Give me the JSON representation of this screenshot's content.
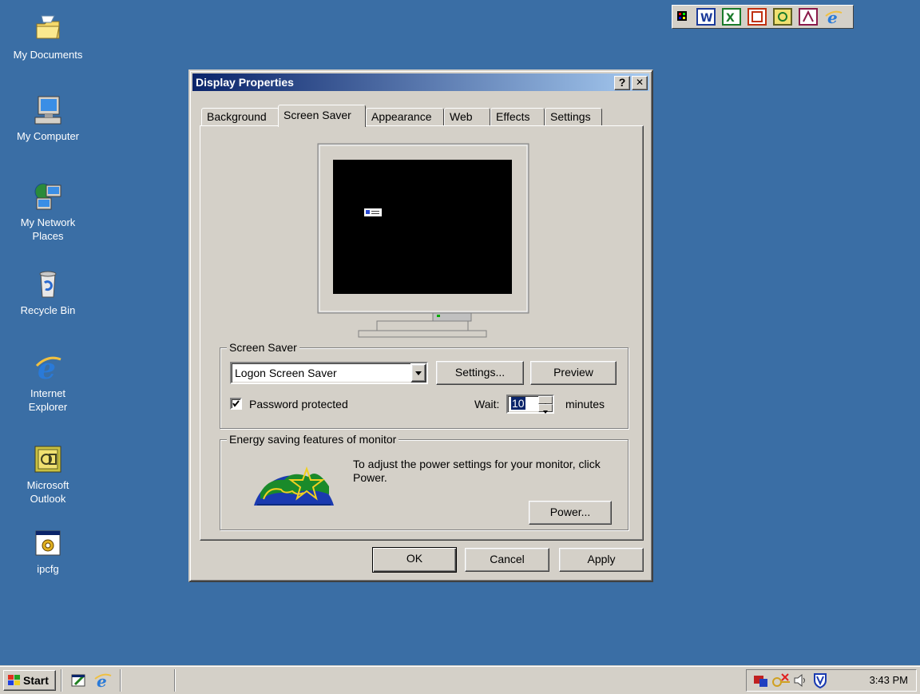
{
  "desktop": {
    "icons": [
      {
        "label": "My Documents"
      },
      {
        "label": "My Computer"
      },
      {
        "label": "My Network Places"
      },
      {
        "label": "Recycle Bin"
      },
      {
        "label": "Internet Explorer"
      },
      {
        "label": "Microsoft Outlook"
      },
      {
        "label": "ipcfg"
      }
    ]
  },
  "window": {
    "title": "Display Properties",
    "help_btn": "?",
    "close_btn": "✕",
    "tabs": [
      {
        "label": "Background"
      },
      {
        "label": "Screen Saver"
      },
      {
        "label": "Appearance"
      },
      {
        "label": "Web"
      },
      {
        "label": "Effects"
      },
      {
        "label": "Settings"
      }
    ],
    "screensaver": {
      "group_label": "Screen Saver",
      "selected": "Logon Screen Saver",
      "settings_btn": "Settings...",
      "preview_btn": "Preview",
      "password_label": "Password protected",
      "wait_label": "Wait:",
      "wait_value": "10",
      "minutes_label": "minutes"
    },
    "energy": {
      "group_label": "Energy saving features of monitor",
      "text": "To adjust the power settings for your monitor, click Power.",
      "power_btn": "Power..."
    },
    "ok_btn": "OK",
    "cancel_btn": "Cancel",
    "apply_btn": "Apply"
  },
  "taskbar": {
    "start_label": "Start",
    "clock": "3:43 PM"
  },
  "colors": {
    "desktop": "#3a6ea5",
    "face": "#d4d0c8",
    "title_start": "#0a246a",
    "title_end": "#a6caf0"
  }
}
